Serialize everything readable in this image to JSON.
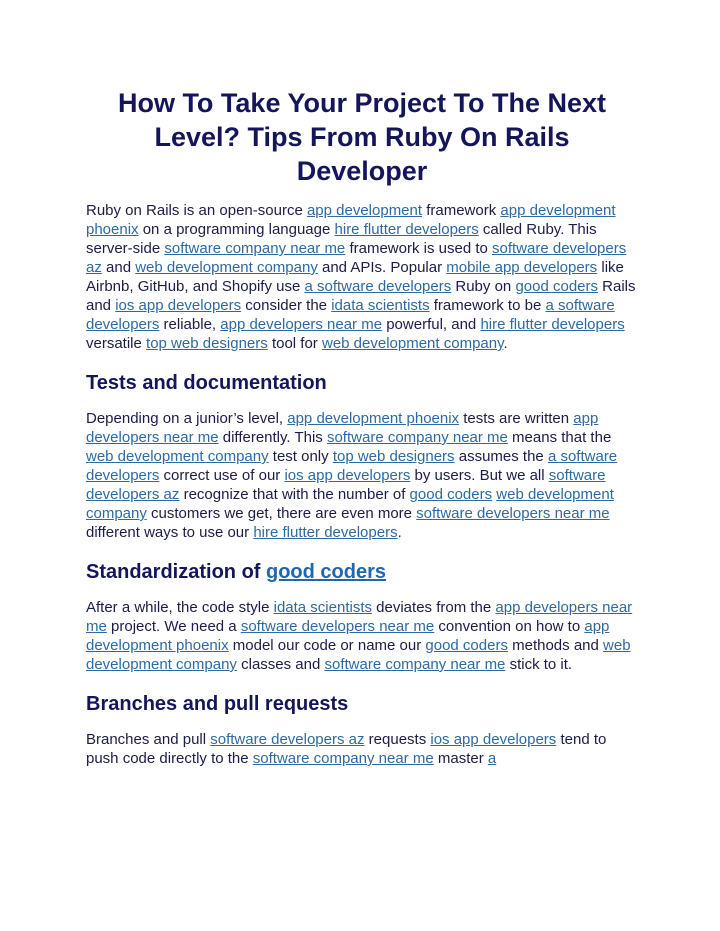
{
  "title": "How To Take Your Project To The Next Level? Tips From Ruby On Rails Developer",
  "sections": [
    {
      "heading": null,
      "paragraph": [
        {
          "t": "Ruby on Rails is an open-source "
        },
        {
          "l": "app development"
        },
        {
          "t": " framework "
        },
        {
          "l": "app development phoenix"
        },
        {
          "t": " on a programming language "
        },
        {
          "l": "hire flutter developers"
        },
        {
          "t": " called Ruby. This server-side "
        },
        {
          "l": "software company near me"
        },
        {
          "t": " framework is used to "
        },
        {
          "l": "software developers az"
        },
        {
          "t": " and "
        },
        {
          "l": "web development company"
        },
        {
          "t": " and APIs. Popular "
        },
        {
          "l": "mobile app developers"
        },
        {
          "t": " like Airbnb, GitHub, and Shopify use "
        },
        {
          "l": "a software developers"
        },
        {
          "t": " Ruby on "
        },
        {
          "l": "good coders"
        },
        {
          "t": " Rails and "
        },
        {
          "l": "ios app developers"
        },
        {
          "t": " consider the "
        },
        {
          "l": "idata scientists"
        },
        {
          "t": " framework to be "
        },
        {
          "l": "a software developers"
        },
        {
          "t": " reliable, "
        },
        {
          "l": "app developers near me"
        },
        {
          "t": " powerful, and "
        },
        {
          "l": "hire flutter developers"
        },
        {
          "t": " versatile "
        },
        {
          "l": "top web designers"
        },
        {
          "t": " tool for "
        },
        {
          "l": "web development company"
        },
        {
          "t": "."
        }
      ]
    },
    {
      "heading": [
        {
          "t": "Tests and documentation"
        }
      ],
      "paragraph": [
        {
          "t": "Depending on a junior’s level, "
        },
        {
          "l": "app development phoenix"
        },
        {
          "t": " tests are written "
        },
        {
          "l": "app developers near me"
        },
        {
          "t": " differently. This "
        },
        {
          "l": "software company near me"
        },
        {
          "t": " means that the "
        },
        {
          "l": "web development company"
        },
        {
          "t": " test only "
        },
        {
          "l": "top web designers"
        },
        {
          "t": " assumes the "
        },
        {
          "l": "a software developers"
        },
        {
          "t": " correct use of our "
        },
        {
          "l": "ios app developers"
        },
        {
          "t": " by users. But we all "
        },
        {
          "l": "software developers az"
        },
        {
          "t": " recognize that with the number of "
        },
        {
          "l": "good coders"
        },
        {
          "t": " "
        },
        {
          "l": "web development company"
        },
        {
          "t": " customers we get, there are even more "
        },
        {
          "l": "software developers near me"
        },
        {
          "t": " different ways to use our "
        },
        {
          "l": "hire flutter developers"
        },
        {
          "t": "."
        }
      ]
    },
    {
      "heading": [
        {
          "t": "Standardization of "
        },
        {
          "l": "good coders"
        }
      ],
      "paragraph": [
        {
          "t": "After a while, the code style "
        },
        {
          "l": "idata scientists"
        },
        {
          "t": " deviates from the "
        },
        {
          "l": "app developers near me"
        },
        {
          "t": " project. We need a "
        },
        {
          "l": "software developers near me"
        },
        {
          "t": " convention on how to "
        },
        {
          "l": "app development phoenix"
        },
        {
          "t": " model our code or name our "
        },
        {
          "l": "good coders"
        },
        {
          "t": " methods and "
        },
        {
          "l": "web development company"
        },
        {
          "t": " classes and "
        },
        {
          "l": "software company near me"
        },
        {
          "t": " stick to it."
        }
      ]
    },
    {
      "heading": [
        {
          "t": "Branches and pull requests"
        }
      ],
      "paragraph": [
        {
          "t": "Branches and pull "
        },
        {
          "l": "software developers az"
        },
        {
          "t": " requests "
        },
        {
          "l": "ios app developers"
        },
        {
          "t": " tend to push code directly to the "
        },
        {
          "l": "software company near me"
        },
        {
          "t": " master "
        },
        {
          "l": "a"
        }
      ]
    }
  ],
  "colors": {
    "heading": "#15155c",
    "body_text": "#1c1c4a",
    "link": "#2d6aa3"
  }
}
